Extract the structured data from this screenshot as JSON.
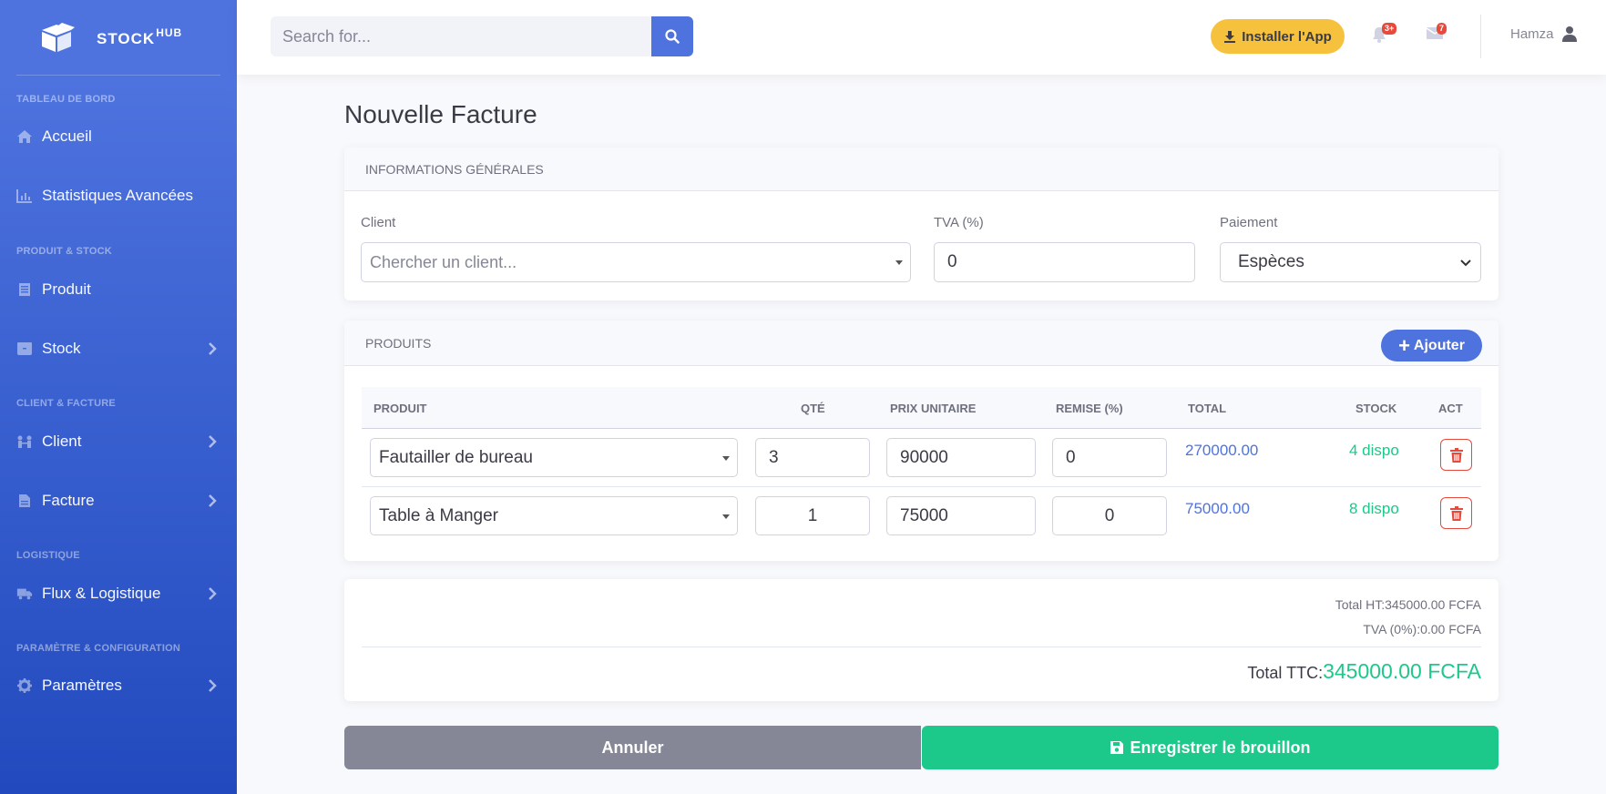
{
  "brand": {
    "name": "STOCK",
    "sup": "HUB"
  },
  "sidebar": {
    "headings": [
      "TABLEAU DE BORD",
      "PRODUIT & STOCK",
      "CLIENT & FACTURE",
      "LOGISTIQUE",
      "PARAMÈTRE & CONFIGURATION"
    ],
    "items": [
      {
        "label": "Accueil",
        "icon": "home-icon"
      },
      {
        "label": "Statistiques Avancées",
        "icon": "chart-icon"
      },
      {
        "label": "Produit",
        "icon": "product-icon"
      },
      {
        "label": "Stock",
        "icon": "box-icon",
        "chevron": true
      },
      {
        "label": "Client",
        "icon": "users-icon",
        "chevron": true
      },
      {
        "label": "Facture",
        "icon": "file-icon",
        "chevron": true
      },
      {
        "label": "Flux & Logistique",
        "icon": "truck-icon",
        "chevron": true
      },
      {
        "label": "Paramètres",
        "icon": "gear-icon",
        "chevron": true
      }
    ]
  },
  "topbar": {
    "search_placeholder": "Search for...",
    "install_label": "Installer l'App",
    "alerts_badge": "3+",
    "messages_badge": "7",
    "user_name": "Hamza"
  },
  "page": {
    "title": "Nouvelle Facture"
  },
  "general": {
    "header": "INFORMATIONS GÉNÉRALES",
    "client_label": "Client",
    "client_placeholder": "Chercher un client...",
    "tva_label": "TVA (%)",
    "tva_value": "0",
    "payment_label": "Paiement",
    "payment_value": "Espèces"
  },
  "products": {
    "header": "PRODUITS",
    "add_label": "Ajouter",
    "columns": [
      "PRODUIT",
      "QTÉ",
      "PRIX UNITAIRE",
      "REMISE (%)",
      "TOTAL",
      "STOCK",
      "ACT"
    ],
    "rows": [
      {
        "product": "Fautailler de bureau",
        "qty": "3",
        "price": "90000",
        "discount": "0",
        "total": "270000.00",
        "stock": "4 dispo"
      },
      {
        "product": "Table à Manger",
        "qty": "1",
        "price": "75000",
        "discount": "0",
        "total": "75000.00",
        "stock": "8 dispo"
      }
    ]
  },
  "summary": {
    "total_ht": "Total HT:345000.00 FCFA",
    "tva": "TVA (0%):0.00 FCFA",
    "ttc_label": "Total TTC:",
    "ttc_value": "345000.00 FCFA"
  },
  "actions": {
    "cancel_label": "Annuler",
    "save_label": "Enregistrer le brouillon"
  },
  "colors": {
    "primary": "#4e73df",
    "success": "#1cc88a",
    "warning": "#f6c23e",
    "danger": "#e74a3b",
    "secondary": "#858796"
  }
}
